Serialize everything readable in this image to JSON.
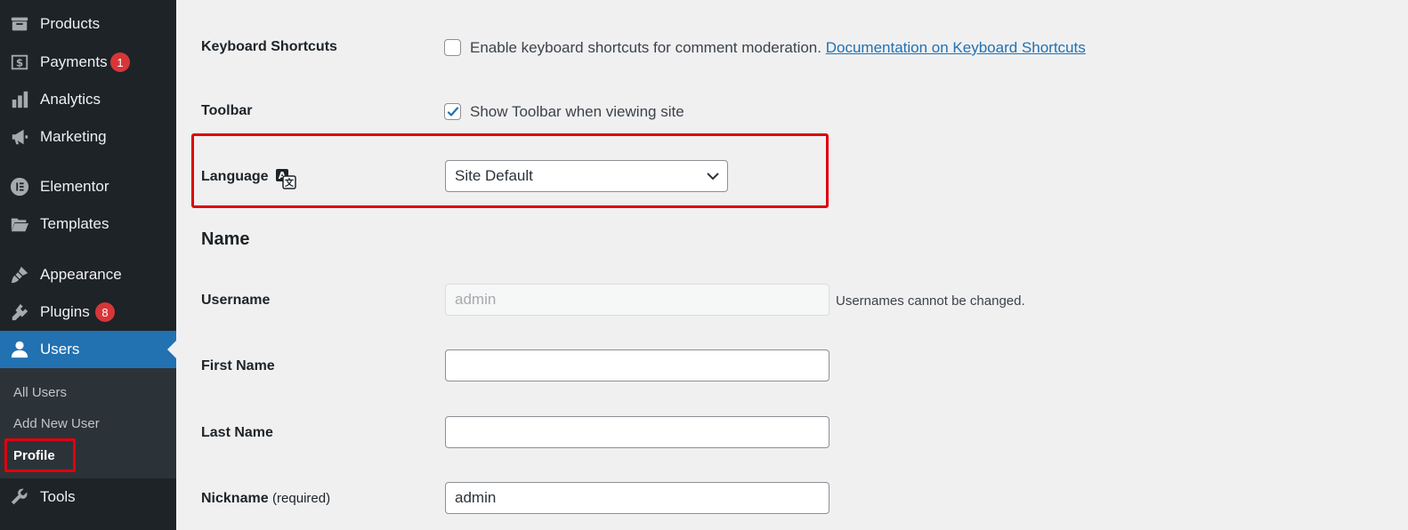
{
  "sidebar": {
    "items": [
      {
        "label": "Products",
        "icon": "products-icon"
      },
      {
        "label": "Payments",
        "icon": "payments-icon",
        "badge": "1"
      },
      {
        "label": "Analytics",
        "icon": "analytics-icon"
      },
      {
        "label": "Marketing",
        "icon": "megaphone-icon"
      },
      {
        "label": "Elementor",
        "icon": "elementor-icon"
      },
      {
        "label": "Templates",
        "icon": "folder-icon"
      },
      {
        "label": "Appearance",
        "icon": "paintbrush-icon"
      },
      {
        "label": "Plugins",
        "icon": "plugin-icon",
        "badge": "8"
      },
      {
        "label": "Users",
        "icon": "user-icon"
      },
      {
        "label": "Tools",
        "icon": "wrench-icon"
      }
    ],
    "active_item": "Users",
    "submenu": [
      {
        "label": "All Users"
      },
      {
        "label": "Add New User"
      },
      {
        "label": "Profile"
      }
    ],
    "current_submenu": "Profile"
  },
  "form": {
    "keyboard_shortcuts": {
      "label": "Keyboard Shortcuts",
      "checked": false,
      "text": "Enable keyboard shortcuts for comment moderation.",
      "link": "Documentation on Keyboard Shortcuts"
    },
    "toolbar": {
      "label": "Toolbar",
      "checked": true,
      "text": "Show Toolbar when viewing site"
    },
    "language": {
      "label": "Language",
      "value": "Site Default"
    },
    "name_section_title": "Name",
    "username": {
      "label": "Username",
      "value": "admin",
      "note": "Usernames cannot be changed."
    },
    "first_name": {
      "label": "First Name",
      "value": ""
    },
    "last_name": {
      "label": "Last Name",
      "value": ""
    },
    "nickname": {
      "label": "Nickname",
      "required": "(required)",
      "value": "admin"
    }
  },
  "colors": {
    "sidebar_bg": "#1d2327",
    "submenu_bg": "#2c3338",
    "active_bg": "#2271b1",
    "badge": "#d63638",
    "highlight_box": "#e0000e",
    "link": "#2271b1",
    "page_bg": "#f0f0f1"
  }
}
